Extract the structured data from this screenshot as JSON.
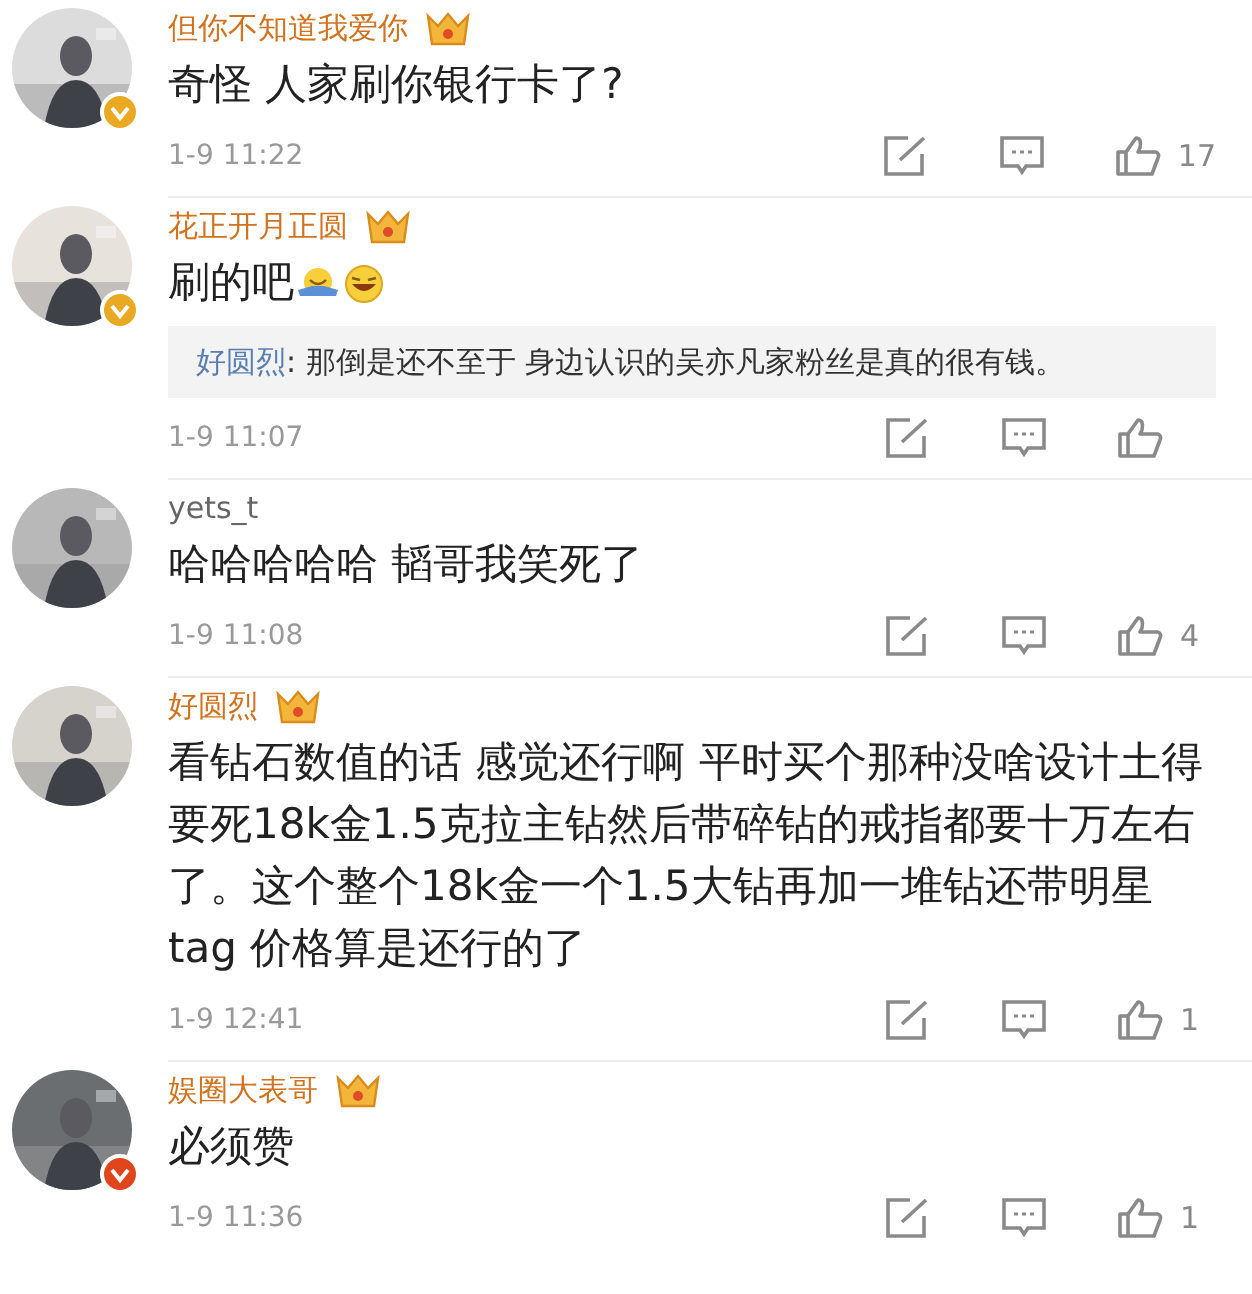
{
  "comments": [
    {
      "name": "但你不知道我爱你",
      "vip": true,
      "color": "#e9a923",
      "text": "奇怪 人家刷你银行卡了?",
      "emoji": false,
      "time": "1-9 11:22",
      "likes": "17"
    },
    {
      "name": "花正开月正圆",
      "vip": true,
      "color": "#e9a923",
      "text": "刷的吧",
      "emoji": true,
      "reply": {
        "author": "好圆烈",
        "text": ": 那倒是还不至于 身边认识的吴亦凡家粉丝是真的很有钱。"
      },
      "time": "1-9 11:07"
    },
    {
      "name": "yets_t",
      "vip": false,
      "text": "哈哈哈哈哈 韬哥我笑死了",
      "emoji": false,
      "time": "1-9 11:08",
      "likes": "4"
    },
    {
      "name": "好圆烈",
      "vip": true,
      "text": "看钻石数值的话 感觉还行啊 平时买个那种没啥设计土得要死18k金1.5克拉主钻然后带碎钻的戒指都要十万左右了。这个整个18k金一个1.5大钻再加一堆钻还带明星tag 价格算是还行的了",
      "emoji": false,
      "time": "1-9 12:41",
      "likes": "1"
    },
    {
      "name": "娱圈大表哥",
      "vip": true,
      "color": "#e0461c",
      "text": "必须赞",
      "emoji": false,
      "time": "1-9 11:36",
      "likes": "1"
    }
  ]
}
